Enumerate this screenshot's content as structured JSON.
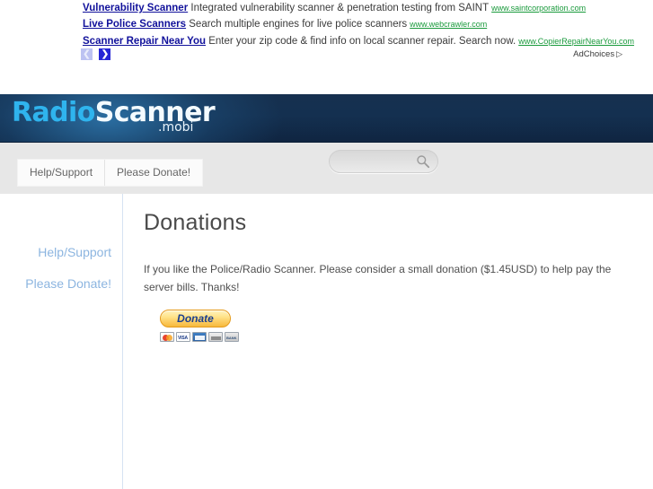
{
  "ads": {
    "items": [
      {
        "title": "Vulnerability Scanner",
        "description": "Integrated vulnerability scanner & penetration testing from SAINT",
        "url": "www.saintcorporation.com"
      },
      {
        "title": "Live Police Scanners",
        "description": "Search multiple engines for live police scanners",
        "url": "www.webcrawler.com"
      },
      {
        "title": "Scanner Repair Near You",
        "description": "Enter your zip code & find info on local scanner repair. Search now.",
        "url": "www.CopierRepairNearYou.com"
      }
    ],
    "prev_label": "❮",
    "next_label": "❯",
    "adchoices_label": "AdChoices",
    "adchoices_icon": "▷",
    "link_color": "#11119b",
    "url_color": "#1a9a3c"
  },
  "header": {
    "logo_primary": "Radio",
    "logo_secondary": "Scanner",
    "logo_suffix": ".mobi",
    "primary_color": "#2fb4ee",
    "banner_color": "#143050"
  },
  "toolbar": {
    "tabs": [
      {
        "label": "Help/Support"
      },
      {
        "label": "Please Donate!"
      }
    ],
    "search": {
      "value": "",
      "placeholder": "",
      "icon": "search-icon"
    }
  },
  "sidebar": {
    "links": [
      {
        "label": "Help/Support"
      },
      {
        "label": "Please Donate!"
      }
    ],
    "link_color": "#8cb5e0"
  },
  "main": {
    "title": "Donations",
    "paragraph": "If you like the Police/Radio Scanner. Please consider a small donation ($1.45USD) to help pay the server bills. Thanks!",
    "donate": {
      "label": "Donate",
      "cards": [
        {
          "name": "mastercard"
        },
        {
          "name": "visa"
        },
        {
          "name": "amex"
        },
        {
          "name": "discover"
        },
        {
          "name": "bank"
        }
      ]
    }
  }
}
